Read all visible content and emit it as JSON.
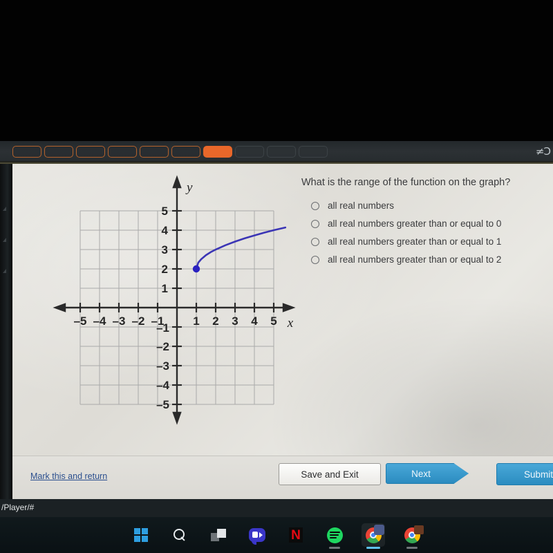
{
  "browser": {
    "tabs": [
      {
        "state": "outline"
      },
      {
        "state": "outline"
      },
      {
        "state": "outline"
      },
      {
        "state": "outline"
      },
      {
        "state": "outline"
      },
      {
        "state": "outline"
      },
      {
        "state": "active"
      },
      {
        "state": "dim"
      },
      {
        "state": "dim"
      },
      {
        "state": "dim"
      }
    ],
    "tabstrip_right_icon": "≠Ɔ",
    "active_tab_color": "#e8672a",
    "tab_outline_color": "#b4622c",
    "status_url": "/Player/#"
  },
  "quiz": {
    "question": "What is the range of the function on the graph?",
    "options": [
      {
        "label": "all real numbers",
        "selected": false
      },
      {
        "label": "all real numbers greater than or equal to 0",
        "selected": false
      },
      {
        "label": "all real numbers greater than or equal to 1",
        "selected": false
      },
      {
        "label": "all real numbers greater than or equal to 2",
        "selected": false
      }
    ]
  },
  "footer": {
    "mark_link": "Mark this and return",
    "save_exit": "Save and Exit",
    "next": "Next",
    "submit": "Submit",
    "link_color": "#2b4f8e",
    "button_color": "#2b8cc0"
  },
  "taskbar": {
    "items": [
      {
        "name": "start",
        "running": false,
        "active": false
      },
      {
        "name": "search",
        "running": false,
        "active": false
      },
      {
        "name": "task-view",
        "running": false,
        "active": false
      },
      {
        "name": "zoom",
        "running": false,
        "active": false
      },
      {
        "name": "netflix",
        "running": false,
        "active": false
      },
      {
        "name": "spotify",
        "running": true,
        "active": false
      },
      {
        "name": "chrome-1",
        "running": true,
        "active": true
      },
      {
        "name": "chrome-2",
        "running": true,
        "active": false
      }
    ]
  },
  "chart_data": {
    "type": "line",
    "title": "",
    "xlabel": "x",
    "ylabel": "y",
    "xlim": [
      -5,
      5
    ],
    "ylim": [
      -5,
      5
    ],
    "xticks": [
      -5,
      -4,
      -3,
      -2,
      -1,
      1,
      2,
      3,
      4,
      5
    ],
    "yticks": [
      5,
      4,
      3,
      2,
      1,
      -1,
      -2,
      -3,
      -4,
      -5
    ],
    "xtick_labels": [
      "–5",
      "–4",
      "–3",
      "–2",
      "–1",
      "1",
      "2",
      "3",
      "4",
      "5"
    ],
    "ytick_labels": [
      "5",
      "4",
      "3",
      "2",
      "1",
      "–1",
      "–2",
      "–3",
      "–4",
      "–5"
    ],
    "grid": true,
    "grid_color": "#a9a9a9",
    "axis_color": "#2a2a2a",
    "series": [
      {
        "name": "square-root-curve",
        "color": "#3b35b5",
        "function": "y = sqrt(x - 1) + 2",
        "domain": [
          1,
          5.6
        ],
        "endpoint": {
          "x": 1,
          "y": 2,
          "type": "closed-dot"
        },
        "points": [
          {
            "x": 1.0,
            "y": 2.0
          },
          {
            "x": 1.1,
            "y": 2.32
          },
          {
            "x": 1.25,
            "y": 2.5
          },
          {
            "x": 1.5,
            "y": 2.71
          },
          {
            "x": 1.75,
            "y": 2.87
          },
          {
            "x": 2.0,
            "y": 3.0
          },
          {
            "x": 2.5,
            "y": 3.22
          },
          {
            "x": 3.0,
            "y": 3.41
          },
          {
            "x": 3.5,
            "y": 3.58
          },
          {
            "x": 4.0,
            "y": 3.73
          },
          {
            "x": 4.5,
            "y": 3.87
          },
          {
            "x": 5.0,
            "y": 4.0
          },
          {
            "x": 5.6,
            "y": 4.14
          }
        ]
      }
    ]
  }
}
